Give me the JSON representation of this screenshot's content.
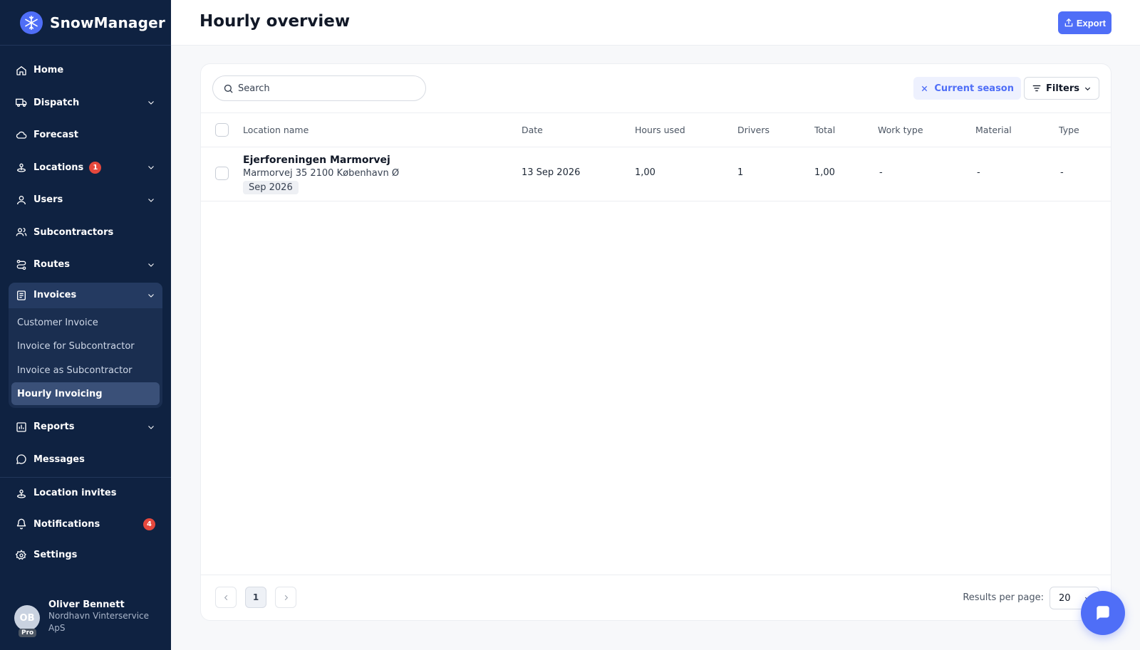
{
  "app": {
    "name": "SnowManager"
  },
  "sidebar": {
    "items": [
      {
        "label": "Home",
        "icon": "home-icon"
      },
      {
        "label": "Dispatch",
        "icon": "truck-icon",
        "expandable": true
      },
      {
        "label": "Forecast",
        "icon": "cloud-icon"
      },
      {
        "label": "Locations",
        "icon": "location-icon",
        "expandable": true,
        "badge": "1"
      },
      {
        "label": "Users",
        "icon": "user-icon",
        "expandable": true
      },
      {
        "label": "Subcontractors",
        "icon": "users-icon"
      },
      {
        "label": "Routes",
        "icon": "route-icon",
        "expandable": true
      }
    ],
    "invoices": {
      "label": "Invoices",
      "icon": "invoice-icon",
      "expanded": true,
      "sub_items": [
        {
          "label": "Customer Invoice"
        },
        {
          "label": "Invoice for Subcontractor"
        },
        {
          "label": "Invoice as Subcontractor"
        },
        {
          "label": "Hourly Invoicing",
          "active": true
        }
      ]
    },
    "items_after": [
      {
        "label": "Reports",
        "icon": "chart-icon",
        "expandable": true
      },
      {
        "label": "Messages",
        "icon": "message-icon"
      }
    ],
    "bottom_items": [
      {
        "label": "Location invites",
        "icon": "location-invite-icon"
      },
      {
        "label": "Notifications",
        "icon": "bell-icon",
        "badge": "4"
      },
      {
        "label": "Settings",
        "icon": "gear-icon"
      }
    ],
    "user": {
      "initials": "OB",
      "plan": "Pro",
      "name": "Oliver Bennett",
      "org": "Nordhavn Vinterservice ApS"
    }
  },
  "header": {
    "title": "Hourly overview",
    "export_label": "Export"
  },
  "toolbar": {
    "search_placeholder": "Search",
    "season_chip": "Current season",
    "filters_label": "Filters"
  },
  "table": {
    "columns": [
      "Location name",
      "Date",
      "Hours used",
      "Drivers",
      "Total",
      "Work type",
      "Material",
      "Type"
    ],
    "rows": [
      {
        "location_name": "Ejerforeningen Marmorvej",
        "address": "Marmorvej 35 2100 København Ø",
        "period": "Sep 2026",
        "date": "13 Sep 2026",
        "hours_used": "1,00",
        "drivers": "1",
        "total": "1,00",
        "work_type": "-",
        "material": "-",
        "type": "-"
      }
    ]
  },
  "pagination": {
    "current_page": "1",
    "results_per_page_label": "Results per page:",
    "results_per_page": "20"
  },
  "colors": {
    "sidebar_bg": "#0f2241",
    "accent": "#4f6ef7",
    "badge": "#e5483d"
  }
}
